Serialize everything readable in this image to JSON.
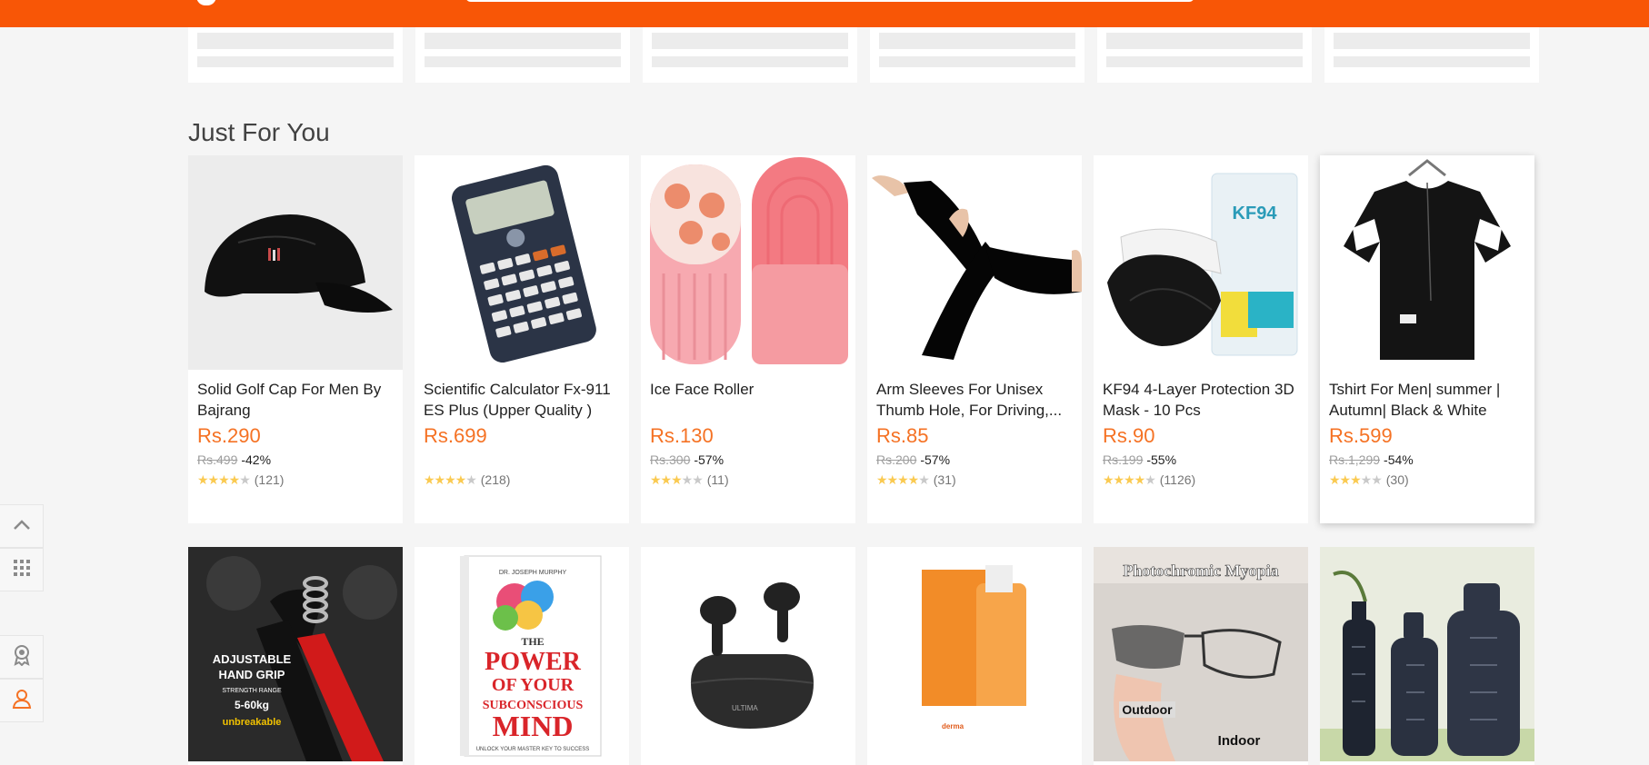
{
  "section_title": "Just For You",
  "products": [
    {
      "name": "Solid Golf Cap For Men By Bajrang",
      "price": "Rs.290",
      "original": "Rs.499",
      "discount": "-42%",
      "rating": 4,
      "reviews": "(121)",
      "image": "cap-image"
    },
    {
      "name": "Scientific Calculator Fx-911 ES Plus (Upper Quality )",
      "price": "Rs.699",
      "original": "",
      "discount": "",
      "rating": 4.5,
      "reviews": "(218)",
      "image": "calculator-image"
    },
    {
      "name": "Ice Face Roller",
      "price": "Rs.130",
      "original": "Rs.300",
      "discount": "-57%",
      "rating": 3,
      "reviews": "(11)",
      "image": "ice-roller-image"
    },
    {
      "name": "Arm Sleeves For Unisex Thumb Hole, For Driving,...",
      "price": "Rs.85",
      "original": "Rs.200",
      "discount": "-57%",
      "rating": 4,
      "reviews": "(31)",
      "image": "arm-sleeves-image"
    },
    {
      "name": "KF94 4-Layer Protection 3D Mask - 10 Pcs",
      "price": "Rs.90",
      "original": "Rs.199",
      "discount": "-55%",
      "rating": 4.5,
      "reviews": "(1126)",
      "image": "mask-image"
    },
    {
      "name": "Tshirt For Men| summer | Autumn| Black & White",
      "price": "Rs.599",
      "original": "Rs.1,299",
      "discount": "-54%",
      "rating": 3.5,
      "reviews": "(30)",
      "image": "tshirt-image"
    }
  ],
  "row2": [
    {
      "image": "hand-grip-image",
      "text1": "ADJUSTABLE",
      "text2": "HAND GRIP",
      "text3": "STRENGTH RANGE",
      "text4": "5-60kg",
      "text5": "unbreakable"
    },
    {
      "image": "book-image",
      "text1": "DR. JOSEPH MURPHY",
      "text2": "THE",
      "text3": "POWER",
      "text4": "OF YOUR",
      "text5": "SUBCONSCIOUS",
      "text6": "MIND",
      "text7": "UNLOCK YOUR MASTER KEY TO SUCCESS"
    },
    {
      "image": "earbuds-image",
      "text1": "ULTIMA"
    },
    {
      "image": "sunscreen-image",
      "text1": "derma"
    },
    {
      "image": "glasses-image",
      "text1": "Photochromic Myopia",
      "text2": "Outdoor",
      "text3": "Indoor"
    },
    {
      "image": "bottles-image"
    }
  ],
  "colors": {
    "brand": "#f85606",
    "price": "#f57224",
    "star": "#faca51"
  },
  "side_tools": [
    "chevron-up-icon",
    "grid-icon",
    "badge-icon",
    "user-icon"
  ]
}
